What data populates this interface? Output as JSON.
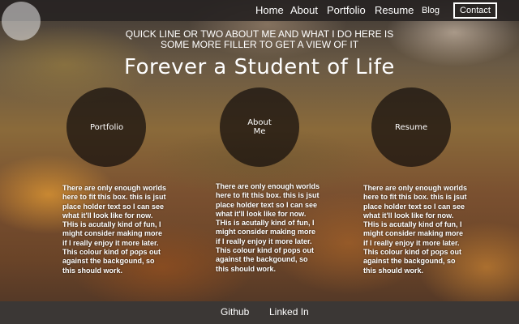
{
  "nav": {
    "home": "Home",
    "about": "About",
    "portfolio": "Portfolio",
    "resume": "Resume",
    "blog": "Blog",
    "contact": "Contact"
  },
  "hero": {
    "tagline": "QUICK LINE OR TWO ABOUT ME AND WHAT I DO HERE IS SOME MORE FILLER TO GET A VIEW OF IT",
    "headline": "Forever a Student of Life"
  },
  "sections": [
    {
      "label": "Portfolio",
      "text": "There are only enough worlds here to fit this box. this is jsut place holder text so I can see what it'll look like for now. THis is acutally kind of fun, I might consider making more if I really enjoy it more later. This colour kind of pops out against the backgound, so this should work."
    },
    {
      "label": "About Me",
      "text": "There are only enough worlds here to fit this box. this is jsut place holder text so I can see what it'll look like for now. THis is acutally kind of fun, I might consider making more if I really enjoy it more later. This colour kind of pops out against the backgound, so this should work."
    },
    {
      "label": "Resume",
      "text": "There are only enough worlds here to fit this box. this is jsut place holder text so I can see what it'll look like for now. THis is acutally kind of fun, I might consider making more if I really enjoy it more later. This colour kind of pops out against the backgound, so this should work."
    }
  ],
  "footer": {
    "github": "Github",
    "linkedin": "Linked In"
  },
  "colors": {
    "nav_bg": "#282423",
    "footer_bg": "#3b3735",
    "text": "#ffffff"
  }
}
